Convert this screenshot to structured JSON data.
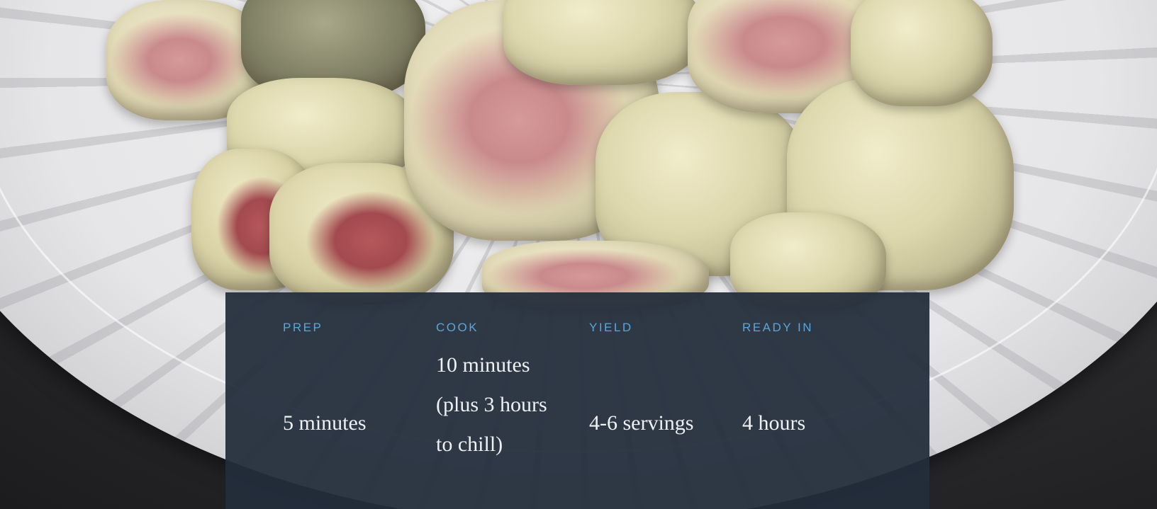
{
  "recipe_info": {
    "prep": {
      "label": "PREP",
      "value": "5 minutes"
    },
    "cook": {
      "label": "COOK",
      "value": "10 minutes (plus 3 hours to chill)"
    },
    "yield": {
      "label": "YIELD",
      "value": "4-6 servings"
    },
    "ready_in": {
      "label": "READY IN",
      "value": "4 hours"
    }
  },
  "colors": {
    "card_background": "#232e3c",
    "label_accent": "#5aa6d8",
    "value_text": "#eef1f4"
  }
}
